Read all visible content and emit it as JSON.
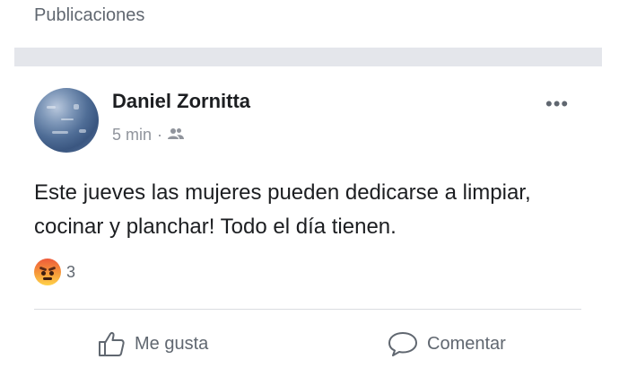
{
  "section": {
    "title": "Publicaciones"
  },
  "post": {
    "author": "Daniel Zornitta",
    "time": "5 min",
    "separator": "·",
    "audience_icon": "friends-icon",
    "text": "Este jueves las mujeres pueden dedicarse a limpiar, cocinar y planchar! Todo el día tienen.",
    "more_label": "•••",
    "reactions": {
      "icon": "angry-reaction-icon",
      "count": "3"
    },
    "actions": [
      {
        "icon": "thumbs-up-icon",
        "label": "Me gusta"
      },
      {
        "icon": "comment-icon",
        "label": "Comentar"
      }
    ]
  },
  "colors": {
    "band": "#e4e6eb",
    "muted": "#606770",
    "text": "#1c1e21"
  }
}
